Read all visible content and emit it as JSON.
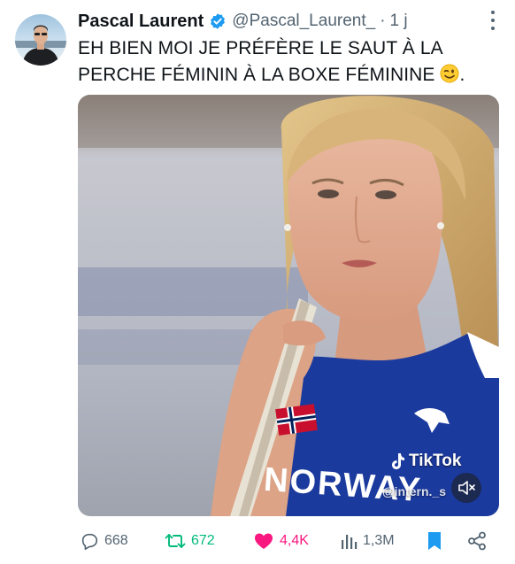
{
  "tweet": {
    "author_name": "Pascal Laurent",
    "handle": "@Pascal_Laurent_",
    "separator": "·",
    "time": "1 j",
    "text": "EH BIEN MOI JE PRÉFÈRE LE SAUT À LA PERCHE FÉMININ À LA BOXE FÉMININE",
    "text_end": ".",
    "emoji": "winking-face",
    "verified": true
  },
  "media": {
    "watermark_brand": "TikTok",
    "watermark_handle": "@intern._s",
    "jersey_text": "NORWAY",
    "muted": true
  },
  "actions": {
    "replies": "668",
    "retweets": "672",
    "likes": "4,4K",
    "views": "1,3M",
    "bookmarked": true
  },
  "colors": {
    "text": "#0f1419",
    "secondary": "#536471",
    "verified": "#1d9bf0",
    "retweet": "#00ba7c",
    "like": "#f91880",
    "bookmark": "#1d9bf0"
  }
}
